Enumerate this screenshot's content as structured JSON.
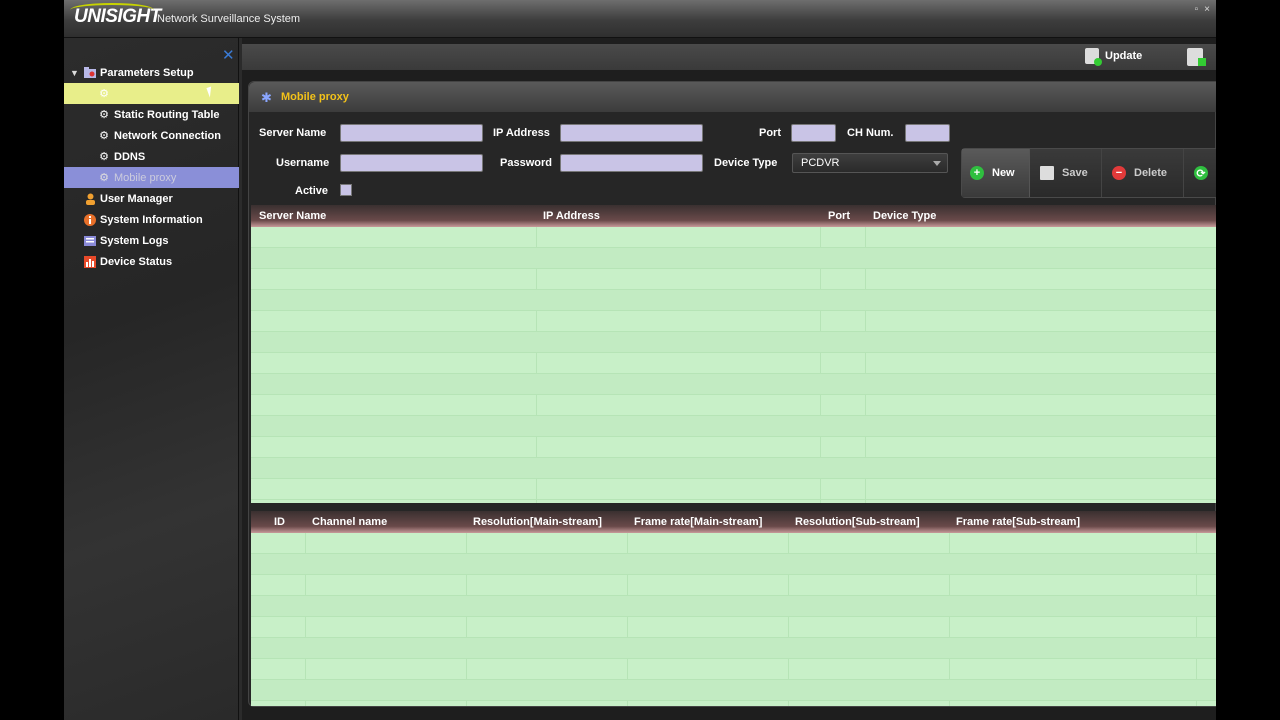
{
  "window": {
    "logo": "UNISIGHT",
    "title": "Network Surveillance System",
    "controls": [
      "▫",
      "×"
    ]
  },
  "sidebar": {
    "close": "✕",
    "tree": {
      "root": "Parameters Setup",
      "children": [
        "",
        "Static Routing Table",
        "Network Connection",
        "DDNS",
        "Mobile proxy"
      ],
      "top_items": [
        "User Manager",
        "System Information",
        "System Logs",
        "Device Status"
      ]
    }
  },
  "toolbar": {
    "update_label": "Update"
  },
  "panel": {
    "title": "Mobile proxy",
    "form": {
      "server_name_label": "Server Name",
      "ip_address_label": "IP Address",
      "port_label": "Port",
      "ch_num_label": "CH Num.",
      "username_label": "Username",
      "password_label": "Password",
      "device_type_label": "Device Type",
      "device_type_value": "PCDVR",
      "active_label": "Active",
      "server_name_value": "",
      "ip_address_value": "",
      "port_value": "",
      "ch_num_value": "",
      "username_value": "",
      "password_value": ""
    },
    "actions": {
      "new": "New",
      "save": "Save",
      "delete": "Delete"
    },
    "server_table": {
      "columns": [
        "Server Name",
        "IP Address",
        "Port",
        "Device Type"
      ]
    },
    "channel_table": {
      "columns": [
        "ID",
        "Channel name",
        "Resolution[Main-stream]",
        "Frame rate[Main-stream]",
        "Resolution[Sub-stream]",
        "Frame rate[Sub-stream]"
      ]
    }
  },
  "colors": {
    "accent_title": "#f3c21a",
    "grid_bg": "#c8f0c8",
    "selected_item": "#8a8fd8",
    "hover_item": "#e8ee8a"
  }
}
